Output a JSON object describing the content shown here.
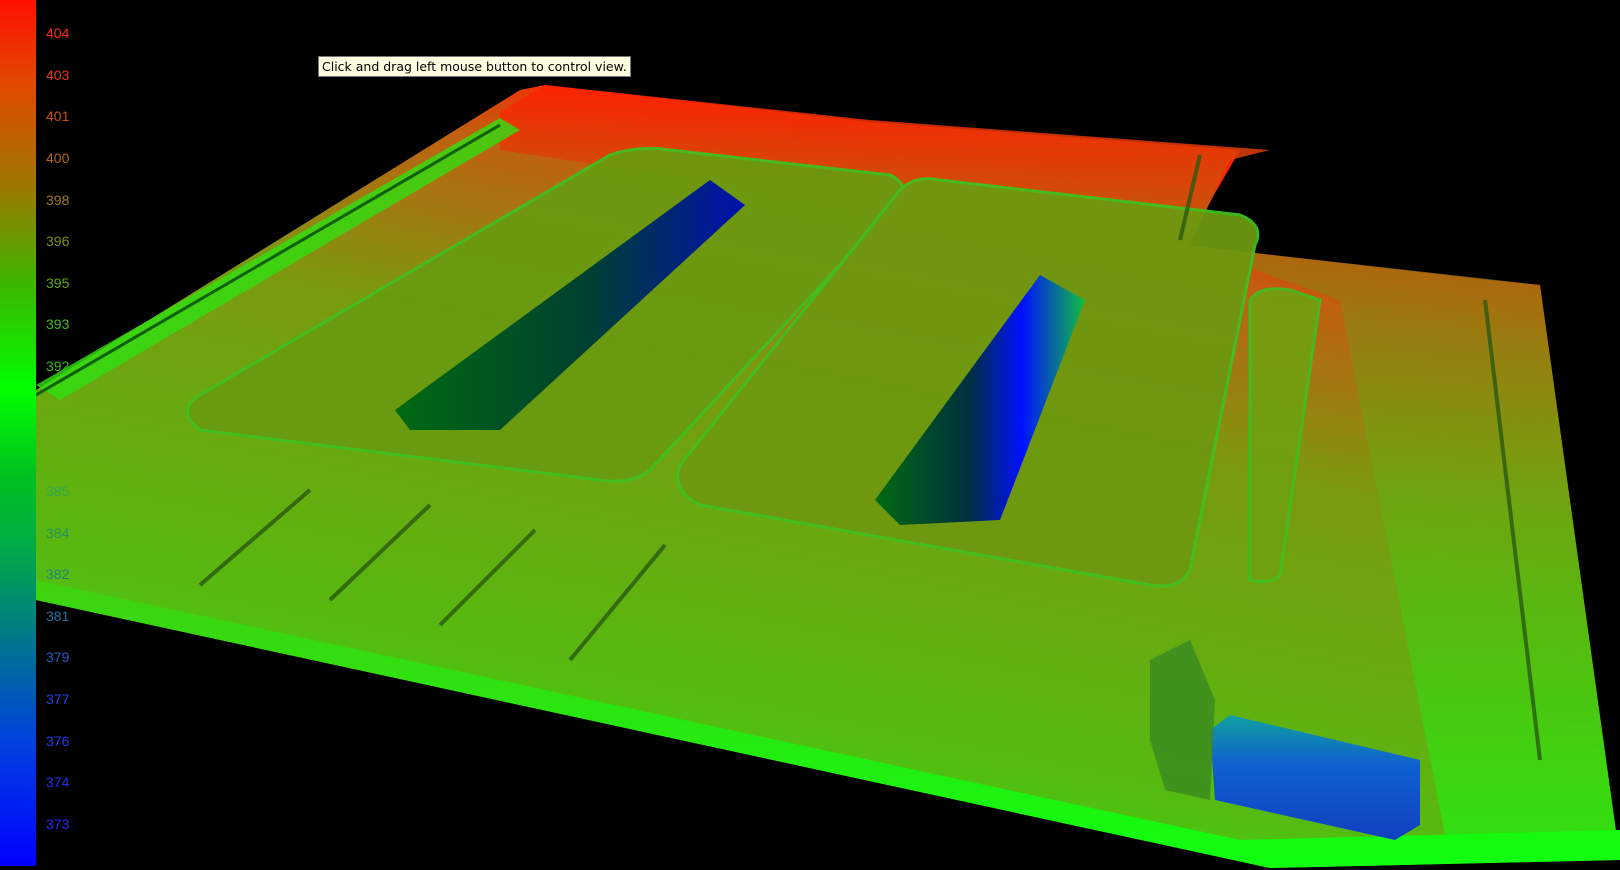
{
  "tooltip": {
    "text": "Click and drag left mouse button to control view."
  },
  "legend": {
    "labels": [
      {
        "value": "404",
        "color": "#ff2a10"
      },
      {
        "value": "403",
        "color": "#e83c10"
      },
      {
        "value": "401",
        "color": "#d05010"
      },
      {
        "value": "400",
        "color": "#b86418"
      },
      {
        "value": "398",
        "color": "#a07818"
      },
      {
        "value": "396",
        "color": "#7e9010"
      },
      {
        "value": "395",
        "color": "#5ca810"
      },
      {
        "value": "393",
        "color": "#40c010"
      },
      {
        "value": "392",
        "color": "#30c010"
      },
      {
        "value": "",
        "color": "#20c020"
      },
      {
        "value": "",
        "color": "#20b020"
      },
      {
        "value": "385",
        "color": "#30a850"
      },
      {
        "value": "384",
        "color": "#2a9060"
      },
      {
        "value": "382",
        "color": "#208080"
      },
      {
        "value": "381",
        "color": "#2070a0"
      },
      {
        "value": "379",
        "color": "#2858c8"
      },
      {
        "value": "377",
        "color": "#2048e0"
      },
      {
        "value": "376",
        "color": "#2038f0"
      },
      {
        "value": "374",
        "color": "#2030f8"
      },
      {
        "value": "373",
        "color": "#2828ff"
      }
    ]
  },
  "colors": {
    "background": "#000000",
    "high": "#ff1000",
    "mid": "#00ff00",
    "low": "#0000ff",
    "plateau": "#7a9a10"
  }
}
